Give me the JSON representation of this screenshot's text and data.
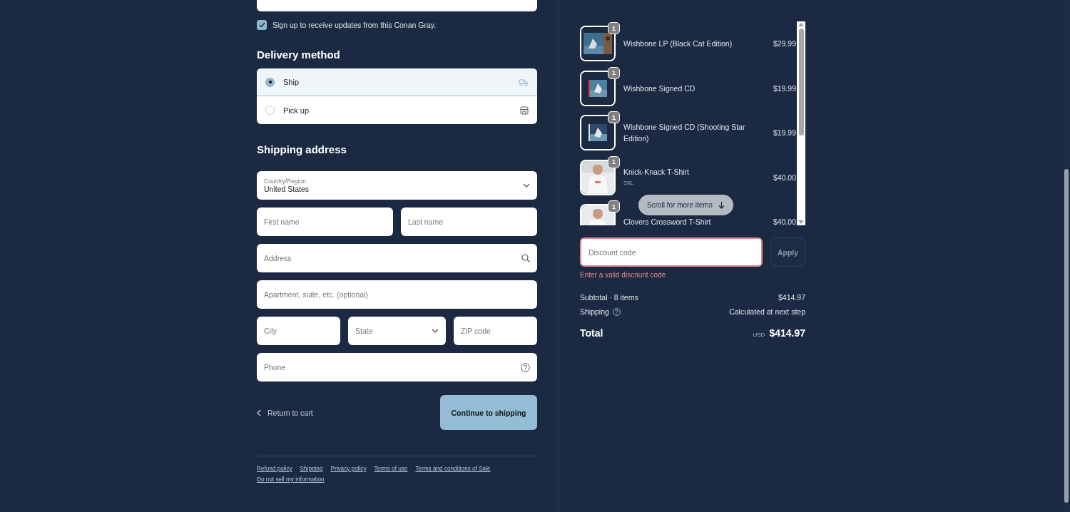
{
  "newsletter": {
    "label": "Sign up to receive updates from this Conan Gray.",
    "checked": true
  },
  "delivery": {
    "heading": "Delivery method",
    "options": [
      {
        "label": "Ship",
        "kind": "ship",
        "selected": true
      },
      {
        "label": "Pick up",
        "kind": "pickup",
        "selected": false
      }
    ]
  },
  "shipping_address": {
    "heading": "Shipping address",
    "country": {
      "label": "Country/Region",
      "value": "United States"
    },
    "first_name": {
      "placeholder": "First name"
    },
    "last_name": {
      "placeholder": "Last name"
    },
    "address": {
      "placeholder": "Address"
    },
    "apartment": {
      "placeholder": "Apartment, suite, etc. (optional)"
    },
    "city": {
      "placeholder": "City"
    },
    "state": {
      "placeholder": "State"
    },
    "zip": {
      "placeholder": "ZIP code"
    },
    "phone": {
      "placeholder": "Phone"
    }
  },
  "return_link": "Return to cart",
  "continue_button": "Continue to shipping",
  "footer_links": [
    "Refund policy",
    "Shipping",
    "Privacy policy",
    "Terms of use",
    "Terms and conditions of Sale",
    "Do not sell my information"
  ],
  "order": {
    "items": [
      {
        "name": "Wishbone LP (Black Cat Edition)",
        "price": "$29.99",
        "quantity": "1",
        "kind": "record"
      },
      {
        "name": "Wishbone Signed CD",
        "price": "$19.99",
        "quantity": "1",
        "kind": "cd"
      },
      {
        "name": "Wishbone Signed CD (Shooting Star Edition)",
        "price": "$19.99",
        "quantity": "1",
        "kind": "cd"
      },
      {
        "name": "Knick-Knack T-Shirt",
        "variant": "3XL",
        "price": "$40.00",
        "quantity": "1",
        "kind": "shirt"
      },
      {
        "name": "Clovers Crossword T-Shirt",
        "price": "$40.00",
        "quantity": "1",
        "kind": "shirt"
      }
    ],
    "scroll_hint": "Scroll for more items",
    "discount": {
      "placeholder": "Discount code",
      "error": "Enter a valid discount code",
      "button": "Apply"
    },
    "subtotal": {
      "label": "Subtotal · 8 items",
      "value": "$414.97"
    },
    "shipping": {
      "label": "Shipping",
      "value": "Calculated at next step"
    },
    "total": {
      "label": "Total",
      "currency": "USD",
      "value": "$414.97"
    }
  }
}
